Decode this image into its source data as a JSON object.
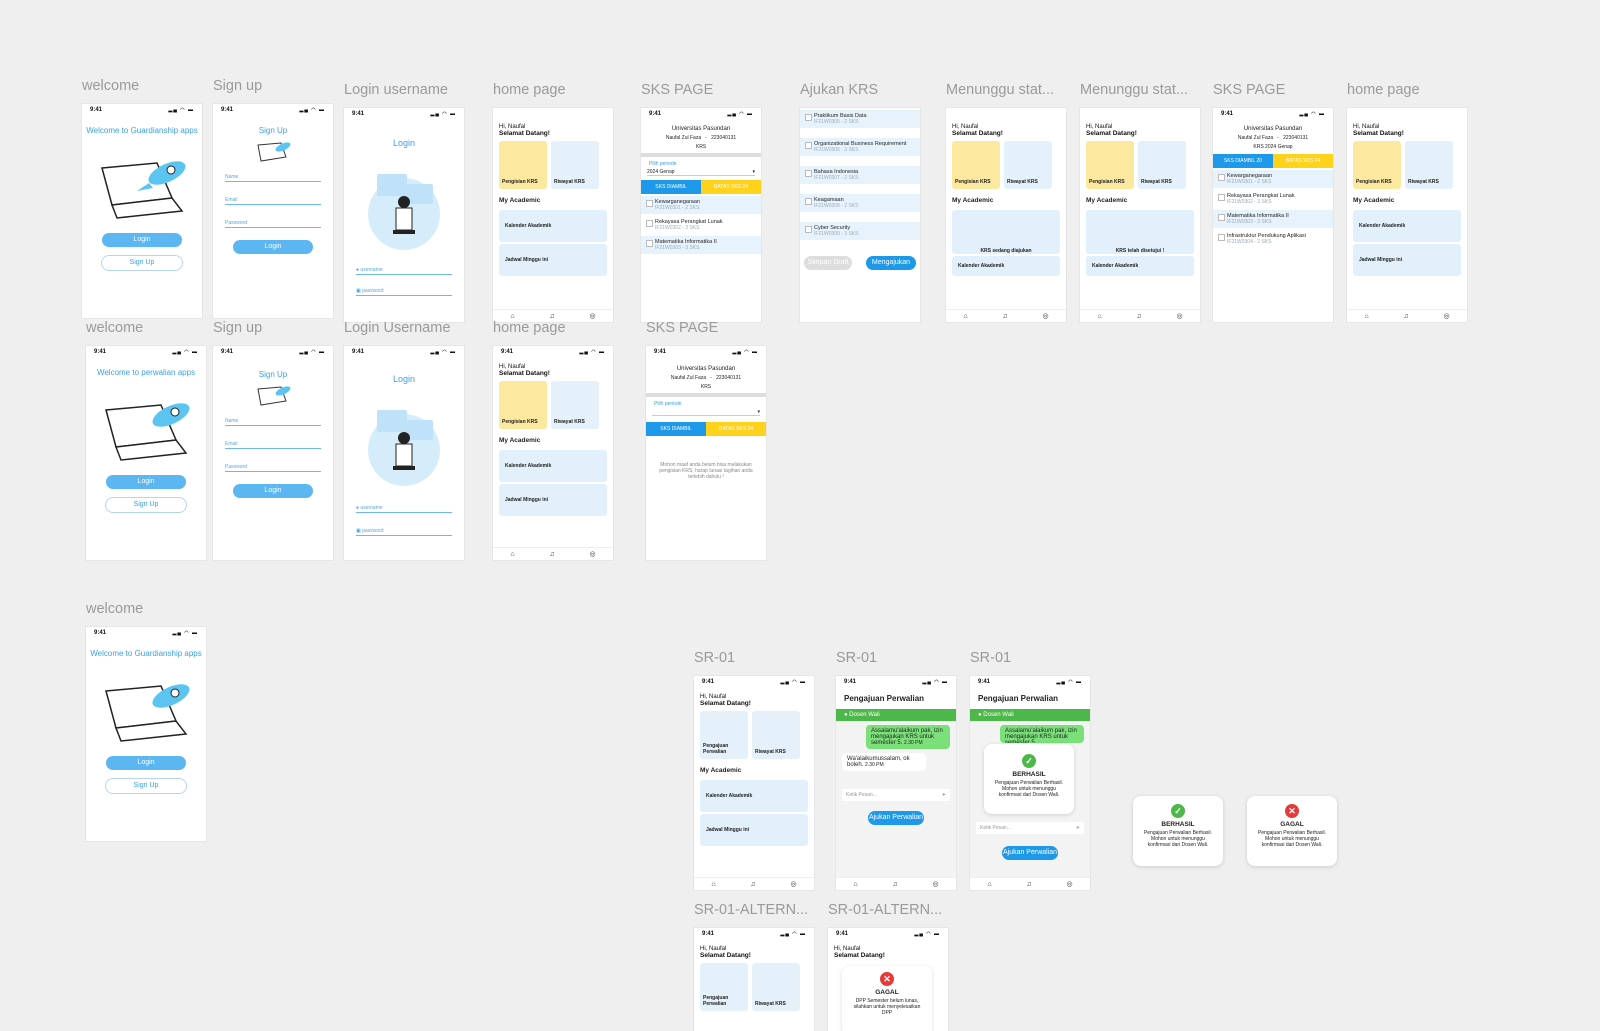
{
  "labels": {
    "welcome": "welcome",
    "sign_up": "Sign up",
    "login_username_lower": "Login username",
    "login_username_upper": "Login Username",
    "home_page": "home page",
    "sks_page": "SKS PAGE",
    "ajukan_krs": "Ajukan KRS",
    "menunggu": "Menunggu stat...",
    "sr01": "SR-01",
    "sr01_alt": "SR-01-ALTERN..."
  },
  "status": {
    "time": "9:41",
    "icons": "▂▄ ◠ ▬"
  },
  "welcome": {
    "title_guard": "Welcome to Guardianship apps",
    "title_perwalian": "Welcome to perwalian apps",
    "login": "Login",
    "signup": "Sign Up"
  },
  "signup": {
    "title": "Sign Up",
    "name": "Name",
    "email": "Email",
    "password": "Password",
    "button": "Login"
  },
  "login": {
    "title": "Login",
    "username": "username",
    "password": "password"
  },
  "home": {
    "hi": "Hi, Naufal",
    "welcome": "Selamat Datang!",
    "card1": "Pengisian KRS",
    "card2": "Riwayat KRS",
    "card1_alt": "Pengajuan Perwalian",
    "academic": "My Academic",
    "calendar": "Kalender Akademik",
    "schedule": "Jadwal Minggu ini",
    "waiting1": "KRS sedang diajukan",
    "waiting2": "KRS telah disetujui !"
  },
  "sks": {
    "univ": "Universitas Pasundan",
    "student": "Naufal Zul Faza",
    "nim": "223040131",
    "krs": "KRS",
    "krs_sem": "KRS 2024 Genap",
    "period_label": "Pilih periode",
    "period": "2024 Genap",
    "taken": "SKS DIAMBIL",
    "taken20": "SKS DIAMBIL 20",
    "limit": "BATAS SKS 24",
    "empty": "Mohon maaf anda belum bisa melakukan pengisian KRS, harap lunasi tagihan anda terlebih dahulu !",
    "courses": [
      {
        "name": "Kewarganegaraan",
        "code": "IF21W0301 - 2 SKS"
      },
      {
        "name": "Rekayasa Perangkat Lunak",
        "code": "IF21W0302 - 3 SKS"
      },
      {
        "name": "Matematika Informatika II",
        "code": "IF21W0303 - 3 SKS"
      },
      {
        "name": "Infrastruktur Pendukung Aplikasi",
        "code": "IF21W0304 - 2 SKS"
      }
    ]
  },
  "ajukan": {
    "courses": [
      {
        "name": "Praktikum Basis Data",
        "code": "IF21W0305 - 2 SKS"
      },
      {
        "name": "Organizational Business Requirement",
        "code": "IF21W0306 - 3 SKS"
      },
      {
        "name": "Bahasa Indonesia",
        "code": "IF21W0307 - 2 SKS"
      },
      {
        "name": "Keagamaan",
        "code": "IF21W0308 - 2 SKS"
      },
      {
        "name": "Cyber Security",
        "code": "IF21W0309 - 3 SKS"
      }
    ],
    "draft": "Simpan Draft",
    "submit": "Mengajukan"
  },
  "chat": {
    "title": "Pengajuan Perwalian",
    "dosen": "Dosen Wali",
    "msg1": "Assalamu'alaikum pak, izin mengajukan KRS untuk semester 5.",
    "msg1_time": "2.30 PM",
    "msg2": "Wa'alaikumussalam, ok boleh.",
    "msg2_time": "2.30 PM",
    "input": "Ketik Pesan...",
    "button": "Ajukan Perwalian"
  },
  "modal": {
    "ok_title": "BERHASIL",
    "ok_text": "Pengajuan Perwalian Berhasil. Mohon untuk menunggu konfirmasi dari Dosen Wali.",
    "fail_title": "GAGAL",
    "fail_text": "Pengajuan Perwalian Berhasil. Mohon untuk menunggu konfirmasi dari Dosen Wali.",
    "fail_text2": "DPP Semester belum lunas, silahkan untuk menyelesaikan DPP"
  },
  "colors": {
    "accent": "#3aa0e6",
    "yellow": "#ffd21c",
    "green": "#4cb849",
    "red": "#e63a3a",
    "blue_tab": "#1e98e8"
  }
}
